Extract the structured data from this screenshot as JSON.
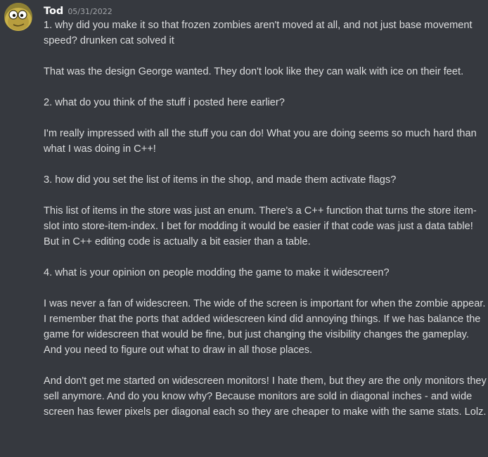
{
  "message": {
    "author": "Tod",
    "timestamp": "05/31/2022",
    "paragraphs": [
      "1. why did you make it so that frozen zombies aren't moved at all, and not just base movement speed? drunken cat solved it",
      "That was the design George wanted. They don't look like they can walk with ice on their feet.",
      "2. what do you think of the stuff i posted here earlier?",
      "I'm really impressed with all the stuff you can do! What you are doing seems so much hard than what I was doing in C++!",
      "3. how did you set the list of items in the shop, and made them activate flags?",
      "This list of items in the store was just an enum. There's a C++ function that turns the store item-slot into store-item-index. I bet for modding it would be easier if that code was just a data table! But in C++ editing code is actually a bit easier than a table.",
      "4. what is your opinion on people modding the game to make it widescreen?",
      "I was never a fan of widescreen. The wide of the screen is important for when the zombie appear. I remember that the ports that added widescreen kind did annoying things. If we has balance the game for widescreen that would be fine, but just changing the visibility changes the gameplay. And you need to figure out what to draw in all those places.",
      "And don't get me started on widescreen monitors! I hate them, but they are the only monitors they sell anymore. And do you know why? Because monitors are sold in diagonal inches - and wide screen has fewer pixels per diagonal each so they are cheaper to make with the same stats. Lolz."
    ]
  },
  "colors": {
    "background": "#36393f",
    "username": "#ffffff",
    "timestamp": "#a3a6aa",
    "text": "#dcddde"
  },
  "icons": {
    "avatar": "yellow-cartoon-face-avatar"
  }
}
